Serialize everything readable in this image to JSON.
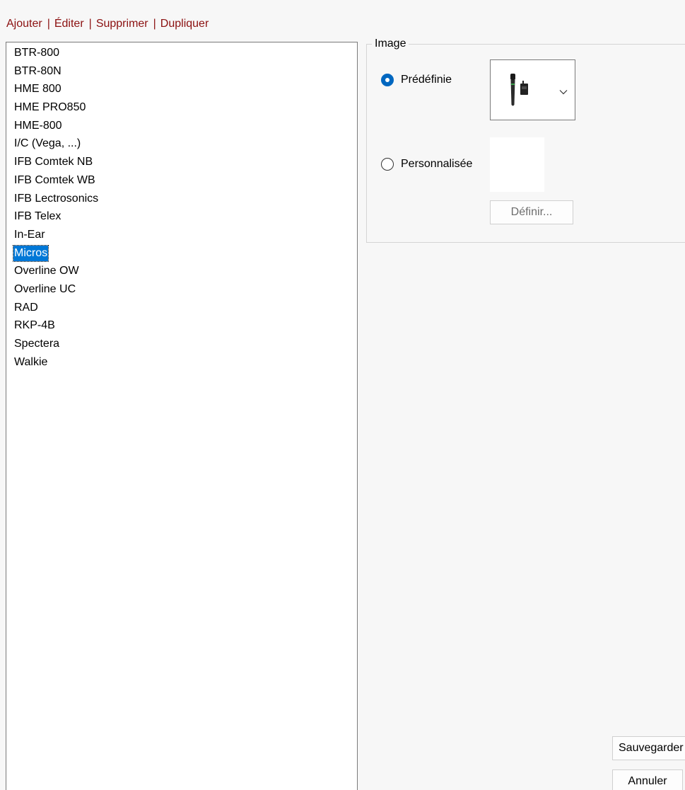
{
  "toolbar": {
    "add_label": "Ajouter",
    "edit_label": "Éditer",
    "delete_label": "Supprimer",
    "duplicate_label": "Dupliquer",
    "separator": "|"
  },
  "list": {
    "items": [
      "BTR-800",
      "BTR-80N",
      "HME 800",
      "HME PRO850",
      "HME-800",
      "I/C (Vega, ...)",
      "IFB Comtek NB",
      "IFB Comtek WB",
      "IFB Lectrosonics",
      "IFB Telex",
      "In-Ear",
      "Micros",
      "Overline OW",
      "Overline UC",
      "RAD",
      "RKP-4B",
      "Spectera",
      "Walkie"
    ],
    "selected": "Micros"
  },
  "image_group": {
    "title": "Image",
    "predefined_label": "Prédéfinie",
    "predefined_checked": true,
    "predefined_image_icon": "microphone-bodypack-icon",
    "custom_label": "Personnalisée",
    "custom_checked": false,
    "define_button": "Définir..."
  },
  "footer": {
    "save_label": "Sauvegarder",
    "cancel_label": "Annuler"
  },
  "colors": {
    "toolbar_link": "#8b1010",
    "selection": "#0078d7",
    "radio_accent": "#0067c0"
  }
}
